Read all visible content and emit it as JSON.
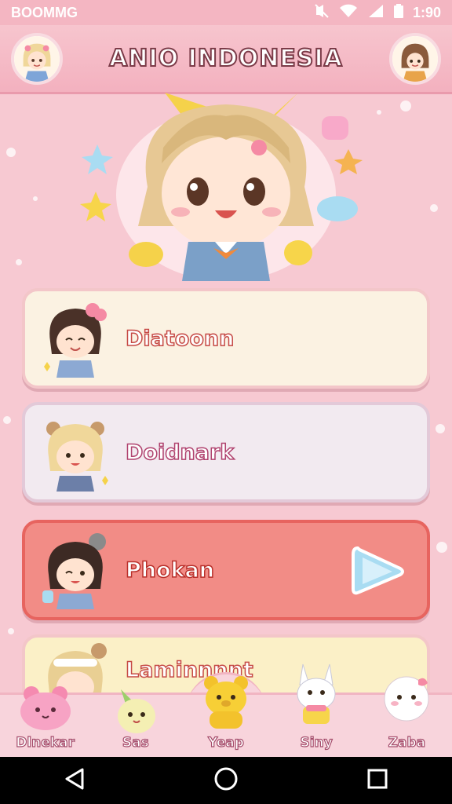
{
  "status_bar": {
    "left_text": "BOOMMG",
    "time": "1:90"
  },
  "header": {
    "title": "ANIO INDONESIA"
  },
  "menu": [
    {
      "label": "Diatoonn"
    },
    {
      "label": "Doidnark"
    },
    {
      "label": "Phokan"
    },
    {
      "label": "Laminnnnt"
    }
  ],
  "bottom_nav": [
    {
      "label": "Dlnekar"
    },
    {
      "label": "Sas"
    },
    {
      "label": "Yeap"
    },
    {
      "label": "Siny"
    },
    {
      "label": "Zaba"
    }
  ],
  "colors": {
    "background": "#f7c9d2",
    "accent_red": "#f28c86",
    "play_blue": "#a9dcf2"
  }
}
